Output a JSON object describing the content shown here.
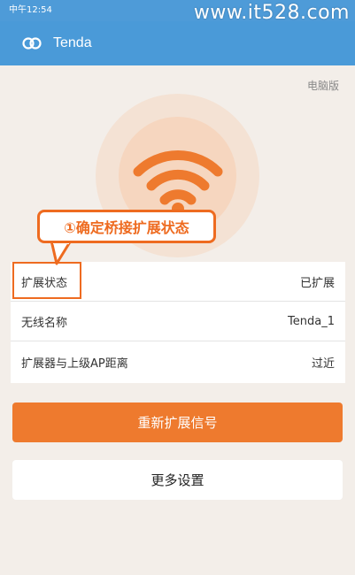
{
  "status_bar": {
    "time": "中午12:54"
  },
  "watermark": "www.it528.com",
  "app_bar": {
    "title": "Tenda",
    "logo_icon": "tenda-logo-icon"
  },
  "hero": {
    "pc_version_label": "电脑版",
    "icon": "wifi-icon"
  },
  "callout": {
    "text": "①确定桥接扩展状态"
  },
  "info": [
    {
      "label": "扩展状态",
      "value": "已扩展"
    },
    {
      "label": "无线名称",
      "value": "Tenda_1"
    },
    {
      "label": "扩展器与上级AP距离",
      "value": "过近"
    }
  ],
  "buttons": {
    "re_extend": "重新扩展信号",
    "more_settings": "更多设置"
  },
  "colors": {
    "app_bar": "#4a9ad8",
    "accent": "#ee7a2e",
    "callout": "#ee6b20"
  }
}
